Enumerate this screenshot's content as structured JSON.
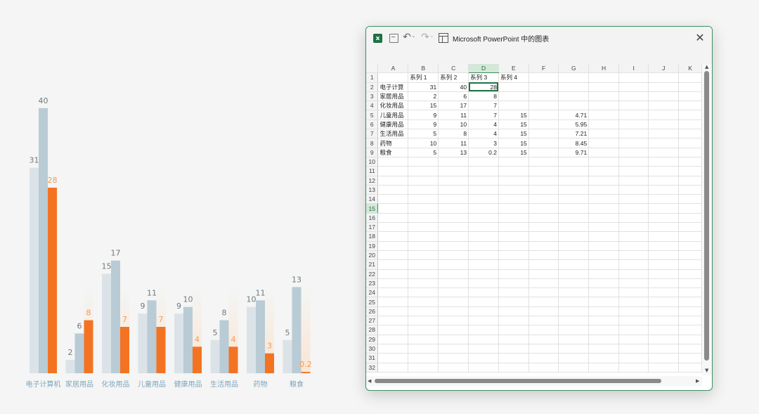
{
  "chart_data": {
    "type": "bar",
    "categories": [
      "电子计算机",
      "家居用品",
      "化妆用品",
      "儿童用品",
      "健康用品",
      "生活用品",
      "药物",
      "粮食"
    ],
    "series": [
      {
        "name": "系列 1",
        "values": [
          31,
          2,
          15,
          9,
          9,
          5,
          10,
          5
        ],
        "color": "#dbe3e8",
        "label_color": "#6f7a80"
      },
      {
        "name": "系列 2",
        "values": [
          40,
          6,
          17,
          11,
          10,
          8,
          11,
          13
        ],
        "color": "#b9cbd5",
        "label_color": "#6f7a80"
      },
      {
        "name": "系列 3",
        "values": [
          28,
          8,
          7,
          7,
          4,
          4,
          3,
          0.2
        ],
        "color": "#f47322",
        "label_color": "#f59a52"
      }
    ],
    "ylim": [
      0,
      42
    ],
    "category_label_color": "#7fa6bd"
  },
  "window": {
    "title": "Microsoft PowerPoint 中的图表",
    "close": "✕",
    "undo": "↶",
    "redo": "↷",
    "dropdown": "⌄"
  },
  "sheet": {
    "columns": [
      "A",
      "B",
      "C",
      "D",
      "E",
      "F",
      "G",
      "H",
      "I",
      "J",
      "K"
    ],
    "selected_column": "D",
    "selected_row": 15,
    "row_count": 32,
    "rows": [
      [
        "",
        "系列 1",
        "系列 2",
        "系列 3",
        "系列 4",
        "",
        "",
        "",
        "",
        "",
        ""
      ],
      [
        "电子计算",
        "31",
        "40",
        "28",
        "",
        "",
        "",
        "",
        "",
        "",
        ""
      ],
      [
        "家居用品",
        "2",
        "6",
        "8",
        "",
        "",
        "",
        "",
        "",
        "",
        ""
      ],
      [
        "化妆用品",
        "15",
        "17",
        "7",
        "",
        "",
        "",
        "",
        "",
        "",
        ""
      ],
      [
        "儿童用品",
        "9",
        "11",
        "7",
        "15",
        "",
        "4.71",
        "",
        "",
        "",
        ""
      ],
      [
        "健康用品",
        "9",
        "10",
        "4",
        "15",
        "",
        "5.95",
        "",
        "",
        "",
        ""
      ],
      [
        "生活用品",
        "5",
        "8",
        "4",
        "15",
        "",
        "7.21",
        "",
        "",
        "",
        ""
      ],
      [
        "药物",
        "10",
        "11",
        "3",
        "15",
        "",
        "8.45",
        "",
        "",
        "",
        ""
      ],
      [
        "粮食",
        "5",
        "13",
        "0.2",
        "15",
        "",
        "9.71",
        "",
        "",
        "",
        ""
      ]
    ]
  },
  "icons": {
    "excel": "excel-icon",
    "save": "save-icon",
    "undo": "undo-icon",
    "redo": "redo-icon",
    "datasheet": "datasheet-icon",
    "close": "close-icon"
  }
}
